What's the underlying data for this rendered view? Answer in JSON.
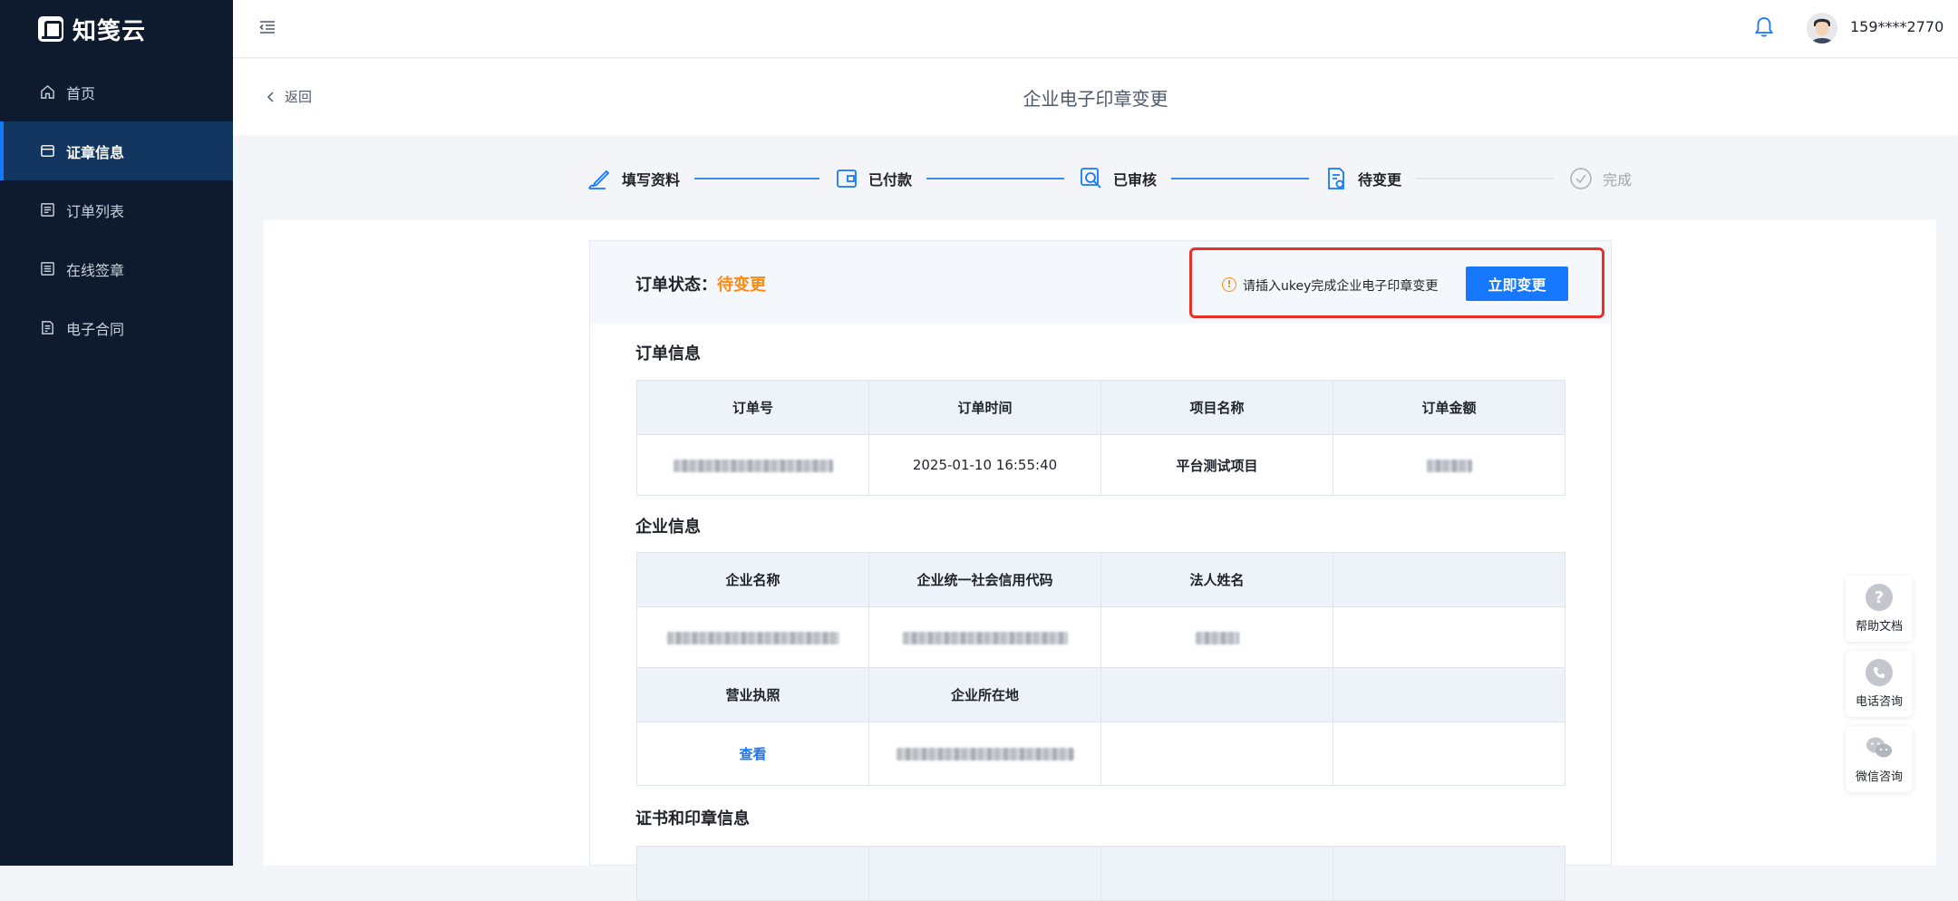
{
  "app": {
    "logo_text": "知笺云"
  },
  "sidebar": {
    "items": [
      {
        "label": "首页",
        "icon": "home-icon",
        "active": false
      },
      {
        "label": "证章信息",
        "icon": "seal-icon",
        "active": true
      },
      {
        "label": "订单列表",
        "icon": "list-icon",
        "active": false
      },
      {
        "label": "在线签章",
        "icon": "sign-icon",
        "active": false
      },
      {
        "label": "电子合同",
        "icon": "contract-icon",
        "active": false
      }
    ]
  },
  "header": {
    "username": "159****2770"
  },
  "titlebar": {
    "back_label": "返回",
    "title": "企业电子印章变更"
  },
  "steps": [
    {
      "label": "填写资料",
      "icon": "pen-icon",
      "state": "done"
    },
    {
      "label": "已付款",
      "icon": "wallet-icon",
      "state": "done"
    },
    {
      "label": "已审核",
      "icon": "review-icon",
      "state": "done"
    },
    {
      "label": "待变更",
      "icon": "change-doc-icon",
      "state": "current"
    },
    {
      "label": "完成",
      "icon": "check-circle-icon",
      "state": "pending"
    }
  ],
  "status": {
    "label": "订单状态：",
    "value": "待变更",
    "alert_text": "请插入ukey完成企业电子印章变更",
    "action_label": "立即变更"
  },
  "order_info": {
    "title": "订单信息",
    "headers": [
      "订单号",
      "订单时间",
      "项目名称",
      "订单金额"
    ],
    "values": [
      "",
      "2025-01-10 16:55:40",
      "平台测试项目",
      ""
    ]
  },
  "company_info": {
    "title": "企业信息",
    "headers_1": [
      "企业名称",
      "企业统一社会信用代码",
      "法人姓名",
      ""
    ],
    "headers_2": [
      "营业执照",
      "企业所在地",
      "",
      ""
    ],
    "view_link": "查看"
  },
  "cert_info": {
    "title": "证书和印章信息"
  },
  "floating": [
    {
      "label": "帮助文档",
      "icon": "help-icon"
    },
    {
      "label": "电话咨询",
      "icon": "phone-icon"
    },
    {
      "label": "微信咨询",
      "icon": "wechat-icon"
    }
  ],
  "colors": {
    "sidebar_bg": "#0e1a2e",
    "active_bg": "#12365f",
    "accent": "#1677ff",
    "status_orange": "#fa8c16",
    "alert_border": "#e8302b"
  }
}
